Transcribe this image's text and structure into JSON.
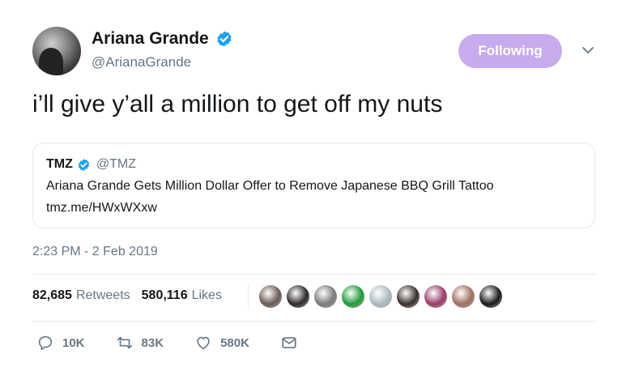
{
  "author": {
    "display_name": "Ariana Grande",
    "handle": "@ArianaGrande",
    "verified": true
  },
  "follow_button": {
    "label": "Following",
    "color": "#c6acec"
  },
  "tweet": {
    "text": "i’ll give y’all a million to get off my nuts",
    "timestamp": "2:23 PM - 2 Feb 2019"
  },
  "quoted_tweet": {
    "name": "TMZ",
    "handle": "@TMZ",
    "verified": true,
    "text": "Ariana Grande Gets Million Dollar Offer to Remove Japanese BBQ Grill Tattoo",
    "link": "tmz.me/HWxWXxw"
  },
  "stats": {
    "retweets_count": "82,685",
    "retweets_label": "Retweets",
    "likes_count": "580,116",
    "likes_label": "Likes"
  },
  "liker_avatars": [
    {
      "name": "liker-1",
      "color": "#6b5a55"
    },
    {
      "name": "liker-2",
      "color": "#2e2a2a"
    },
    {
      "name": "liker-3",
      "color": "#7a7a7a"
    },
    {
      "name": "liker-4",
      "color": "#1f9a3a"
    },
    {
      "name": "liker-5",
      "color": "#aab8c2"
    },
    {
      "name": "liker-6",
      "color": "#3a2f2b"
    },
    {
      "name": "liker-7",
      "color": "#9b3a6a"
    },
    {
      "name": "liker-8",
      "color": "#a07060"
    },
    {
      "name": "liker-9",
      "color": "#1a1a1a"
    }
  ],
  "actions": {
    "reply_count": "10K",
    "retweet_count": "83K",
    "like_count": "580K"
  },
  "colors": {
    "text_primary": "#14171a",
    "text_secondary": "#657786",
    "verified_blue": "#1da1f2",
    "border": "#e1e8ed"
  },
  "icons": [
    "verified-badge-icon",
    "chevron-down-icon",
    "reply-icon",
    "retweet-icon",
    "like-heart-icon",
    "direct-message-icon"
  ]
}
